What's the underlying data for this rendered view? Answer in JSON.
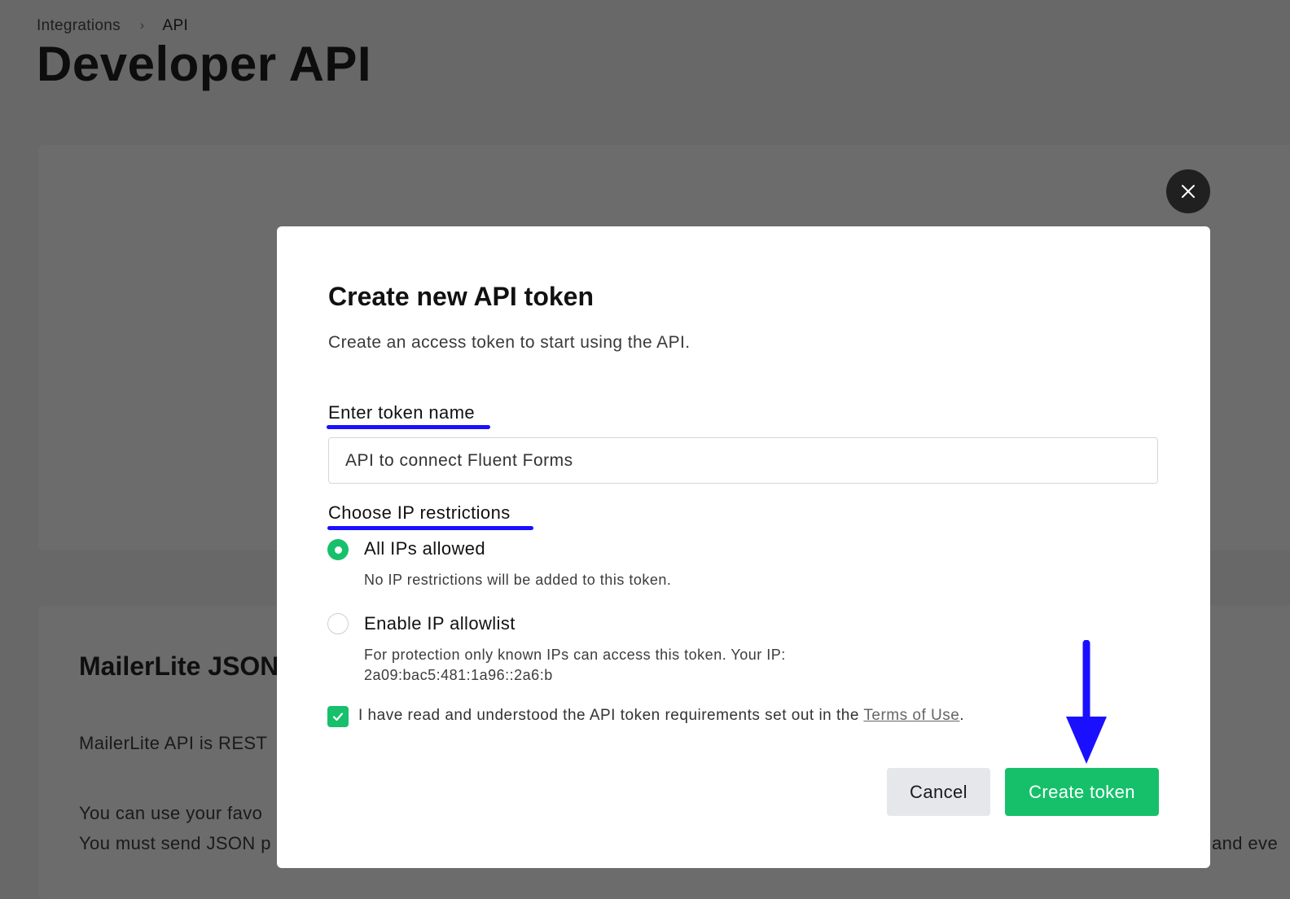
{
  "breadcrumb": {
    "parent": "Integrations",
    "separator": "›",
    "current": "API"
  },
  "page": {
    "title": "Developer API"
  },
  "background": {
    "heading": "MailerLite JSON",
    "text_1": "MailerLite API is REST",
    "text_2": "You can use your favo",
    "text_3": "You must send JSON p",
    "text_right": "and eve"
  },
  "modal": {
    "title": "Create new API token",
    "subtitle": "Create an access token to start using the API.",
    "token_label": "Enter token name",
    "token_value": "API to connect Fluent Forms",
    "ip_label": "Choose IP restrictions",
    "options": [
      {
        "label": "All IPs allowed",
        "description": "No IP restrictions will be added to this token.",
        "selected": true
      },
      {
        "label": "Enable IP allowlist",
        "description_line1": "For protection only known IPs can access this token. Your IP:",
        "description_line2": "2a09:bac5:481:1a96::2a6:b",
        "selected": false
      }
    ],
    "terms": {
      "checked": true,
      "text": "I have read and understood the API token requirements set out in the ",
      "link": "Terms of Use",
      "suffix": "."
    },
    "buttons": {
      "cancel": "Cancel",
      "create": "Create token"
    }
  },
  "icons": {
    "close": "close-icon",
    "chevron": "chevron-right-icon",
    "check": "check-icon",
    "annotation_arrow": "arrow-down-icon"
  },
  "colors": {
    "accent_green": "#16c06a",
    "annotation_blue": "#1a10ff",
    "overlay": "#686868"
  }
}
